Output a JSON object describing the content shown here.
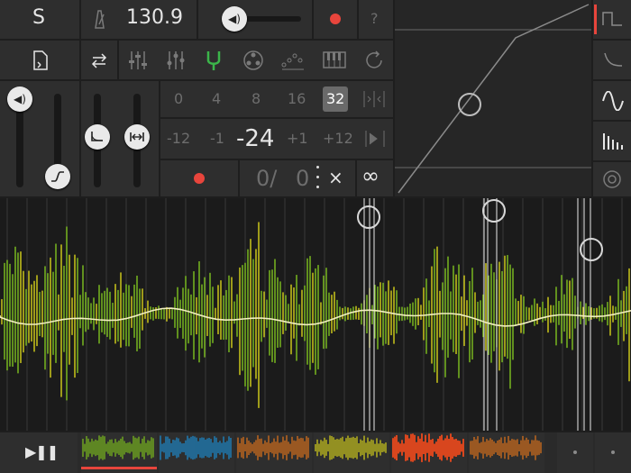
{
  "top": {
    "s_label": "S",
    "tempo": "130.9",
    "help": "?"
  },
  "grid": {
    "values": [
      "0",
      "4",
      "8",
      "16",
      "32"
    ],
    "selected": "32"
  },
  "nudge": {
    "values": [
      "-12",
      "-1",
      "-24",
      "+1",
      "+12"
    ]
  },
  "counter": {
    "left": "0/",
    "right": "0",
    "close": "×",
    "loop": "∞"
  },
  "transport": {
    "play_pause": "▶❚❚"
  },
  "icons": {
    "metronome": "metronome-icon",
    "volume": "speaker-icon",
    "record": "record-dot-icon",
    "file": "file-icon",
    "swap": "swap-arrows-icon",
    "mixer": "mixer-sliders-icon",
    "eq": "eq-icon",
    "tuner": "tuning-fork-icon",
    "sampler": "reel-icon",
    "sequencer": "sequencer-icon",
    "keyboard": "piano-keys-icon",
    "cycle": "cycle-icon",
    "envelope": "envelope-icon",
    "stretch": "stretch-icon",
    "square_wave": "square-wave-icon",
    "decay": "decay-curve-icon",
    "sine": "sine-wave-icon",
    "bars": "bars-icon",
    "target": "target-icon"
  },
  "colors": {
    "accent_red": "#e8453c",
    "wave_green": "#7fc21f",
    "wave_yellow": "#d7d21a",
    "active_green": "#3bb54a"
  },
  "clips": [
    {
      "name": "clip-1",
      "color": "#7ec21c"
    },
    {
      "name": "clip-2",
      "color": "#1c8fd6"
    },
    {
      "name": "clip-3",
      "color": "#e2761b"
    },
    {
      "name": "clip-4",
      "color": "#d7d21a"
    },
    {
      "name": "clip-5",
      "color": "#d8461e"
    },
    {
      "name": "clip-6",
      "color": "#e2761b"
    }
  ]
}
